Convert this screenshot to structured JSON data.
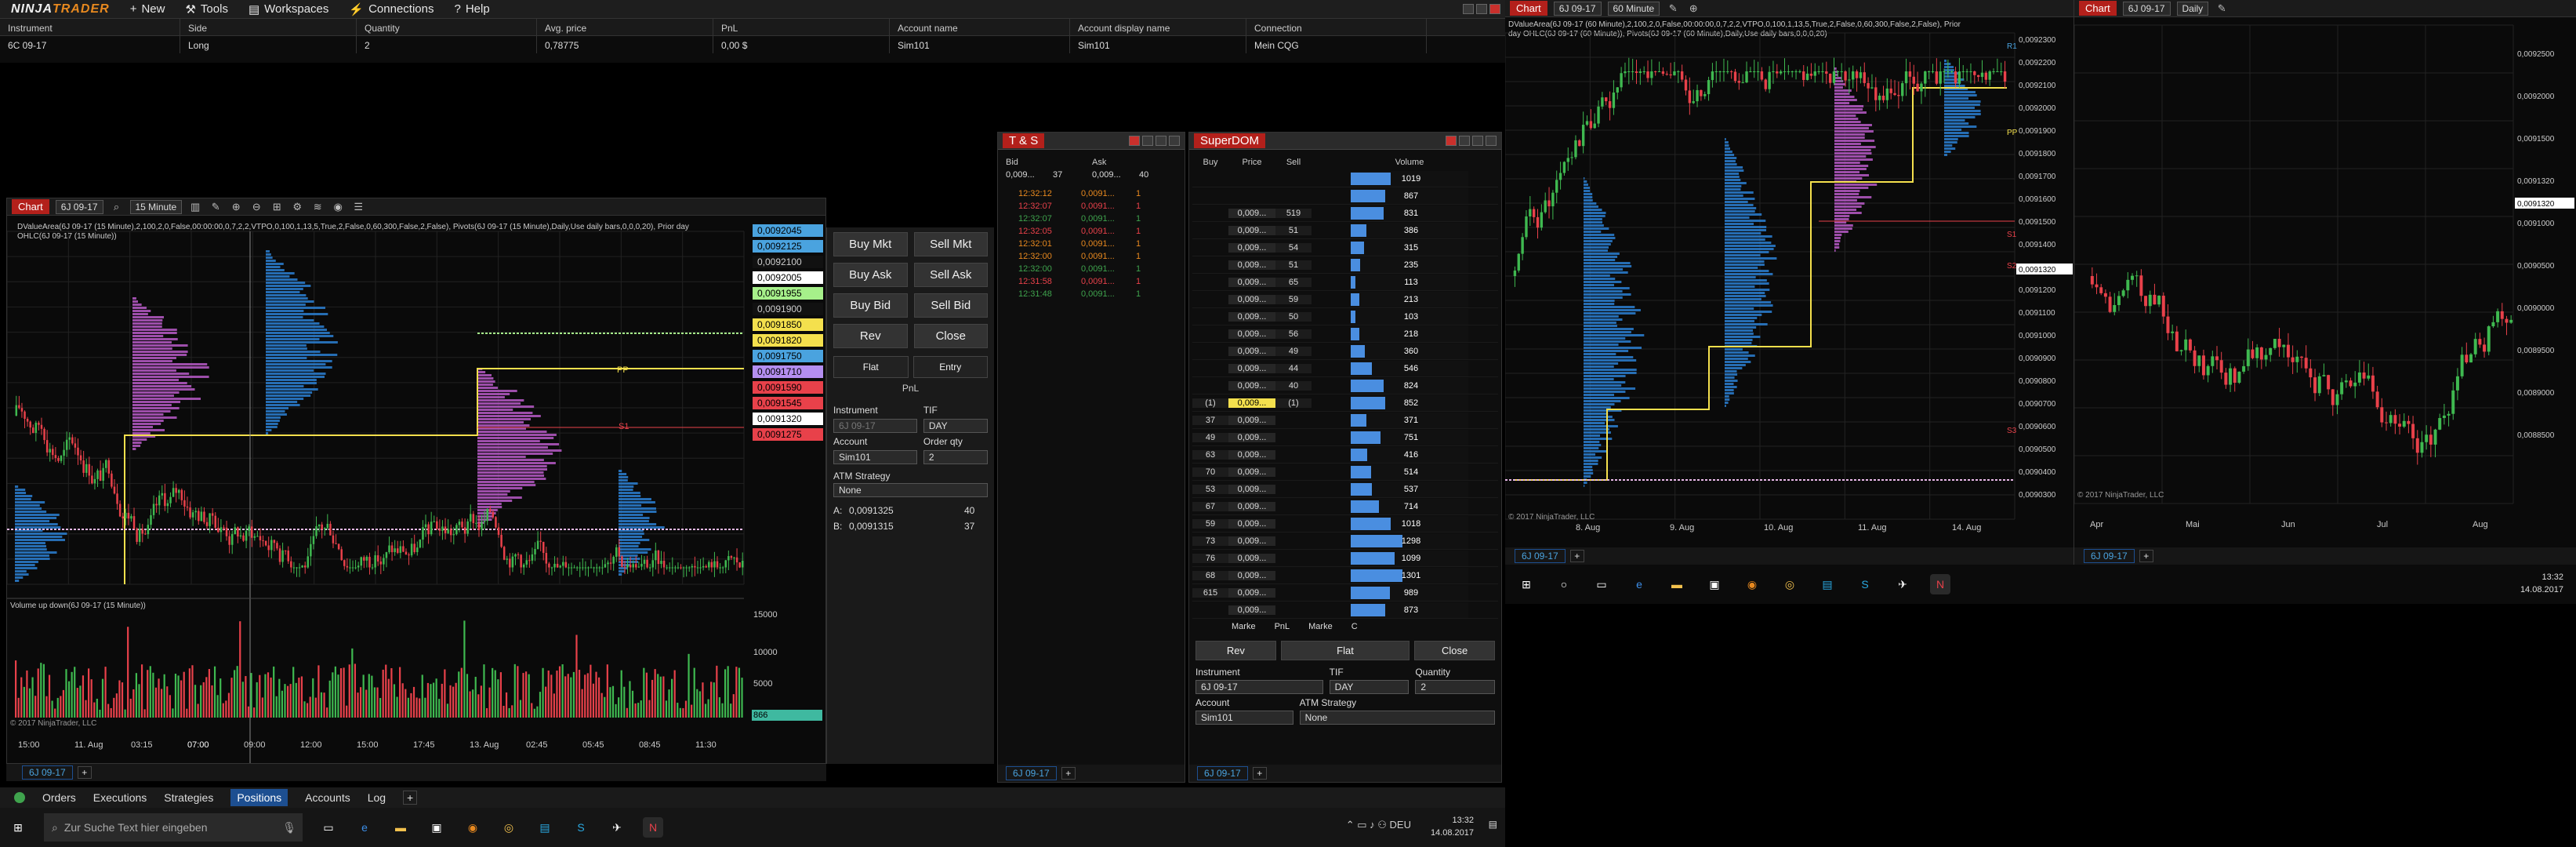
{
  "app": {
    "logo_a": "NINJA",
    "logo_b": "TRADER"
  },
  "menu": [
    {
      "label": "New",
      "icon": "new-icon"
    },
    {
      "label": "Tools",
      "icon": "tools-icon"
    },
    {
      "label": "Workspaces",
      "icon": "workspaces-icon"
    },
    {
      "label": "Connections",
      "icon": "connections-icon"
    },
    {
      "label": "Help",
      "icon": "help-icon"
    }
  ],
  "positions": {
    "headers": [
      "Instrument",
      "Side",
      "Quantity",
      "Avg. price",
      "PnL",
      "Account name",
      "Account display name",
      "Connection"
    ],
    "rows": [
      [
        "6C 09-17",
        "Long",
        "2",
        "0,78775",
        "0,00 $",
        "Sim101",
        "Sim101",
        "Mein CQG"
      ]
    ]
  },
  "chart1": {
    "tag": "Chart",
    "instrument": "6J 09-17",
    "interval": "15 Minute",
    "indicator_text": "DValueArea(6J 09-17 (15 Minute),2,100,2,0,False,00:00:00,0,7,2,2,VTPO,0,100,1,13,5,True,2,False,0,60,300,False,2,False), Pivots(6J 09-17 (15 Minute),Daily,Use daily bars,0,0,0,20), Prior day OHLC(6J 09-17 (15 Minute))",
    "volume_label": "Volume up down(6J 09-17 (15 Minute))",
    "copyright": "© 2017 NinjaTrader, LLC",
    "price_tags": [
      {
        "v": "0,0092045",
        "c": "#4aa3df"
      },
      {
        "v": "0,0092125",
        "c": "#4aa3df"
      },
      {
        "v": "0,0092100",
        "c": "#111"
      },
      {
        "v": "0,0092005",
        "c": "#ffffff"
      },
      {
        "v": "0,0091955",
        "c": "#a6f08a"
      },
      {
        "v": "0,0091900",
        "c": "#111"
      },
      {
        "v": "0,0091850",
        "c": "#f4e04d"
      },
      {
        "v": "0,0091820",
        "c": "#f4e04d"
      },
      {
        "v": "0,0091750",
        "c": "#4aa3df"
      },
      {
        "v": "0,0091710",
        "c": "#b48ef0"
      },
      {
        "v": "0,0091590",
        "c": "#e8414a"
      },
      {
        "v": "0,0091545",
        "c": "#e8414a"
      },
      {
        "v": "0,0091320",
        "c": "#ffffff"
      },
      {
        "v": "0,0091275",
        "c": "#e8414a"
      }
    ],
    "vol_ticks": [
      "15000",
      "10000",
      "5000",
      "866"
    ],
    "x_ticks": [
      "15:00",
      "11. Aug",
      "03:15",
      "07:00",
      "09:00",
      "12:00",
      "15:00",
      "17:45",
      "13. Aug",
      "02:45",
      "05:45",
      "08:45",
      "11:30"
    ],
    "footer_tab": "6J 09-17",
    "pp_label": "PP",
    "s1_label": "S1"
  },
  "chattr": {
    "buttons": [
      [
        "Buy Mkt",
        "Sell Mkt"
      ],
      [
        "Buy Ask",
        "Sell Ask"
      ],
      [
        "Buy Bid",
        "Sell Bid"
      ],
      [
        "Rev",
        "Close"
      ]
    ],
    "flat": "Flat",
    "entry": "Entry",
    "pnl": "PnL",
    "instrument_label": "Instrument",
    "tif_label": "TIF",
    "instrument_val": "6J 09-17",
    "tif_val": "DAY",
    "account_label": "Account",
    "orderqty_label": "Order qty",
    "account_val": "Sim101",
    "orderqty_val": "2",
    "atm_label": "ATM Strategy",
    "atm_val": "None",
    "a_row": [
      "A:",
      "0,0091325",
      "40"
    ],
    "b_row": [
      "B:",
      "0,0091315",
      "37"
    ]
  },
  "ts": {
    "title": "T & S",
    "bid": "Bid",
    "ask": "Ask",
    "bid_val": "0,009...",
    "bid_qty": "37",
    "ask_val": "0,009...",
    "ask_qty": "40",
    "rows": [
      {
        "t": "12:32:12",
        "p": "0,0091...",
        "q": "1",
        "c": "#e8891f"
      },
      {
        "t": "12:32:07",
        "p": "0,0091...",
        "q": "1",
        "c": "#e8414a"
      },
      {
        "t": "12:32:07",
        "p": "0,0091...",
        "q": "1",
        "c": "#3fa34d"
      },
      {
        "t": "12:32:05",
        "p": "0,0091...",
        "q": "1",
        "c": "#e8414a"
      },
      {
        "t": "12:32:01",
        "p": "0,0091...",
        "q": "1",
        "c": "#e8891f"
      },
      {
        "t": "12:32:00",
        "p": "0,0091...",
        "q": "1",
        "c": "#e8891f"
      },
      {
        "t": "12:32:00",
        "p": "0,0091...",
        "q": "1",
        "c": "#3fa34d"
      },
      {
        "t": "12:31:58",
        "p": "0,0091...",
        "q": "1",
        "c": "#e8414a"
      },
      {
        "t": "12:31:48",
        "p": "0,0091...",
        "q": "1",
        "c": "#3fa34d"
      }
    ],
    "footer_tab": "6J 09-17"
  },
  "superdom": {
    "title": "SuperDOM",
    "headers": [
      "Buy",
      "Price",
      "Sell",
      "Volume"
    ],
    "rows": [
      {
        "buy": "",
        "price": "",
        "sell": "",
        "vol": "1019",
        "w": 0.34
      },
      {
        "buy": "",
        "price": "",
        "sell": "",
        "vol": "867",
        "w": 0.29
      },
      {
        "buy": "",
        "price": "0,009...",
        "sell": "519",
        "vol": "831",
        "w": 0.28
      },
      {
        "buy": "",
        "price": "0,009...",
        "sell": "51",
        "vol": "386",
        "w": 0.13
      },
      {
        "buy": "",
        "price": "0,009...",
        "sell": "54",
        "vol": "315",
        "w": 0.11
      },
      {
        "buy": "",
        "price": "0,009...",
        "sell": "51",
        "vol": "235",
        "w": 0.08
      },
      {
        "buy": "",
        "price": "0,009...",
        "sell": "65",
        "vol": "113",
        "w": 0.04
      },
      {
        "buy": "",
        "price": "0,009...",
        "sell": "59",
        "vol": "213",
        "w": 0.07
      },
      {
        "buy": "",
        "price": "0,009...",
        "sell": "50",
        "vol": "103",
        "w": 0.04
      },
      {
        "buy": "",
        "price": "0,009...",
        "sell": "56",
        "vol": "218",
        "w": 0.07
      },
      {
        "buy": "",
        "price": "0,009...",
        "sell": "49",
        "vol": "360",
        "w": 0.12
      },
      {
        "buy": "",
        "price": "0,009...",
        "sell": "44",
        "vol": "546",
        "w": 0.18
      },
      {
        "buy": "",
        "price": "0,009...",
        "sell": "40",
        "vol": "824",
        "w": 0.28
      },
      {
        "buy": "(1)",
        "price": "0,009...",
        "sell": "(1)",
        "vol": "852",
        "w": 0.29
      },
      {
        "buy": "37",
        "price": "0,009...",
        "sell": "",
        "vol": "371",
        "w": 0.13
      },
      {
        "buy": "49",
        "price": "0,009...",
        "sell": "",
        "vol": "751",
        "w": 0.25
      },
      {
        "buy": "63",
        "price": "0,009...",
        "sell": "",
        "vol": "416",
        "w": 0.14
      },
      {
        "buy": "70",
        "price": "0,009...",
        "sell": "",
        "vol": "514",
        "w": 0.17
      },
      {
        "buy": "53",
        "price": "0,009...",
        "sell": "",
        "vol": "537",
        "w": 0.18
      },
      {
        "buy": "67",
        "price": "0,009...",
        "sell": "",
        "vol": "714",
        "w": 0.24
      },
      {
        "buy": "59",
        "price": "0,009...",
        "sell": "",
        "vol": "1018",
        "w": 0.34
      },
      {
        "buy": "73",
        "price": "0,009...",
        "sell": "",
        "vol": "1298",
        "w": 0.44
      },
      {
        "buy": "76",
        "price": "0,009...",
        "sell": "",
        "vol": "1099",
        "w": 0.37
      },
      {
        "buy": "68",
        "price": "0,009...",
        "sell": "",
        "vol": "1301",
        "w": 0.44
      },
      {
        "buy": "615",
        "price": "0,009...",
        "sell": "",
        "vol": "989",
        "w": 0.33
      },
      {
        "buy": "",
        "price": "0,009...",
        "sell": "",
        "vol": "873",
        "w": 0.29
      }
    ],
    "footer": [
      "Marke",
      "PnL",
      "Marke",
      "C"
    ],
    "rev": "Rev",
    "flat": "Flat",
    "close": "Close",
    "instrument_label": "Instrument",
    "tif_label": "TIF",
    "qty_label": "Quantity",
    "instrument_val": "6J 09-17",
    "tif_val": "DAY",
    "qty_val": "2",
    "account_label": "Account",
    "atm_label": "ATM Strategy",
    "account_val": "Sim101",
    "atm_val": "None",
    "footer_tab": "6J 09-17"
  },
  "chart2": {
    "tag": "Chart",
    "instrument": "6J 09-17",
    "interval": "60 Minute",
    "indicator_text": "DValueArea(6J 09-17 (60 Minute),2,100,2,0,False,00:00:00,0,7,2,2,VTPO,0,100,1,13,5,True,2,False,0,60,300,False,2,False), Prior day OHLC(6J 09-17 (60 Minute)), Pivots(6J 09-17 (60 Minute),Daily,Use daily bars,0,0,0,20)",
    "y_ticks": [
      "0,0092300",
      "0,0092200",
      "0,0092100",
      "0,0092000",
      "0,0091900",
      "0,0091800",
      "0,0091700",
      "0,0091600",
      "0,0091500",
      "0,0091400",
      "0,0091320",
      "0,0091200",
      "0,0091100",
      "0,0091000",
      "0,0090900",
      "0,0090800",
      "0,0090700",
      "0,0090600",
      "0,0090500",
      "0,0090400",
      "0,0090300"
    ],
    "x_ticks": [
      "8. Aug",
      "9. Aug",
      "10. Aug",
      "11. Aug",
      "14. Aug"
    ],
    "copyright": "© 2017 NinjaTrader, LLC",
    "footer_tab": "6J 09-17",
    "labels": [
      "R1",
      "PP",
      "S1",
      "S2",
      "S3"
    ]
  },
  "chart3": {
    "tag": "Chart",
    "instrument": "6J 09-17",
    "interval": "Daily",
    "y_ticks": [
      "0,0092500",
      "0,0092000",
      "0,0091500",
      "0,0091320",
      "0,0091000",
      "0,0090500",
      "0,0090000",
      "0,0089500",
      "0,0089000",
      "0,0088500"
    ],
    "x_ticks": [
      "Apr",
      "Mai",
      "Jun",
      "Jul",
      "Aug"
    ],
    "copyright": "© 2017 NinjaTrader, LLC",
    "footer_tab": "6J 09-17"
  },
  "bottom_tabs": [
    "Orders",
    "Executions",
    "Strategies",
    "Positions",
    "Accounts",
    "Log"
  ],
  "active_bottom_tab": "Positions",
  "taskbar1": {
    "search": "Zur Suche Text hier eingeben",
    "time": "13:32",
    "date": "14.08.2017"
  },
  "taskbar2": {
    "time": "13:32",
    "date": "14.08.2017"
  }
}
